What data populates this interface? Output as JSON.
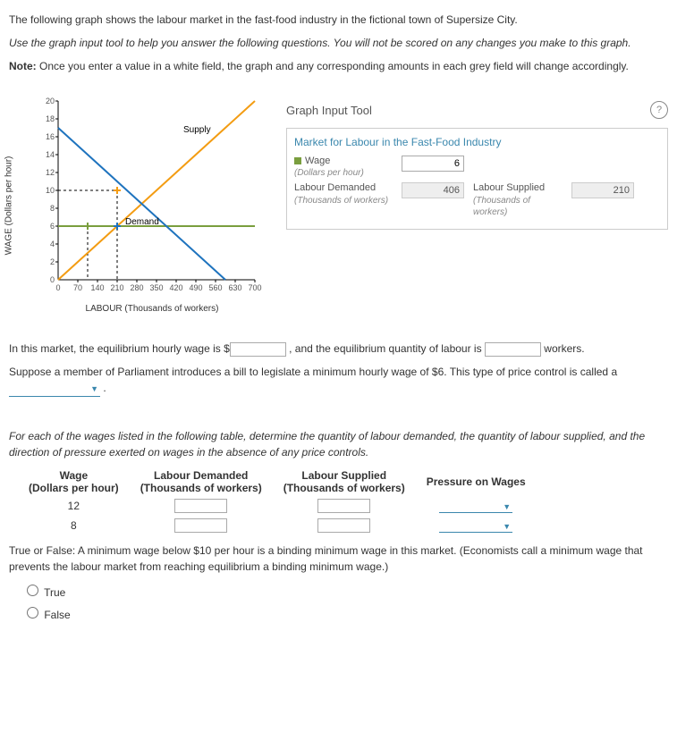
{
  "intro": "The following graph shows the labour market in the fast-food industry in the fictional town of Supersize City.",
  "instruct1": "Use the graph input tool to help you answer the following questions. You will not be scored on any changes you make to this graph.",
  "instruct2_prefix": "Note:",
  "instruct2": " Once you enter a value in a white field, the graph and any corresponding amounts in each grey field will change accordingly.",
  "chart_data": {
    "type": "line",
    "title": "",
    "xlabel": "LABOUR (Thousands of workers)",
    "ylabel": "WAGE (Dollars per hour)",
    "x_ticks": [
      0,
      70,
      140,
      210,
      280,
      350,
      420,
      490,
      560,
      630,
      700
    ],
    "y_ticks": [
      0,
      2,
      4,
      6,
      8,
      10,
      12,
      14,
      16,
      18,
      20
    ],
    "xlim": [
      0,
      700
    ],
    "ylim": [
      0,
      20
    ],
    "series": [
      {
        "name": "Demand",
        "color": "#1e73be",
        "points": [
          [
            0,
            17
          ],
          [
            595,
            0
          ]
        ]
      },
      {
        "name": "Supply",
        "color": "#f39c12",
        "points": [
          [
            0,
            0
          ],
          [
            700,
            20
          ]
        ]
      },
      {
        "name": "Wage line",
        "color": "#7a9e3e",
        "points": [
          [
            0,
            6
          ],
          [
            700,
            6
          ]
        ]
      }
    ],
    "markers": [
      {
        "x": 210,
        "y": 6,
        "color": "#1e73be"
      },
      {
        "x": 105,
        "y": 6,
        "color": "#7a9e3e"
      },
      {
        "x": 210,
        "y": 10,
        "color": "#f39c12"
      }
    ],
    "guides": [
      {
        "type": "v",
        "x": 105,
        "y1": 0,
        "y2": 6
      },
      {
        "type": "v",
        "x": 210,
        "y1": 0,
        "y2": 10
      },
      {
        "type": "h",
        "y": 10,
        "x1": 0,
        "x2": 210
      }
    ]
  },
  "tool": {
    "header": "Graph Input Tool",
    "market_title": "Market for Labour in the Fast-Food Industry",
    "wage_label": "Wage",
    "wage_sub": "(Dollars per hour)",
    "wage_value": "6",
    "demand_label": "Labour Demanded",
    "demand_sub": "(Thousands of workers)",
    "demand_value": "406",
    "supply_label": "Labour Supplied",
    "supply_sub": "(Thousands of workers)",
    "supply_value": "210"
  },
  "q1": {
    "pre": "In this market, the equilibrium hourly wage is ",
    "prefix": "$",
    "mid": " , and the equilibrium quantity of labour is ",
    "suffix": " workers."
  },
  "q2": {
    "text": "Suppose a member of Parliament introduces a bill to legislate a minimum hourly wage of $6. This type of price control is called a ",
    "suffix": " ."
  },
  "q3": {
    "intro": "For each of the wages listed in the following table, determine the quantity of labour demanded, the quantity of labour supplied, and the direction of pressure exerted on wages in the absence of any price controls.",
    "headers": {
      "wage": "Wage",
      "wage_sub": "(Dollars per hour)",
      "demand": "Labour Demanded",
      "demand_sub": "(Thousands of workers)",
      "supply": "Labour Supplied",
      "supply_sub": "(Thousands of workers)",
      "pressure": "Pressure on Wages"
    },
    "rows": [
      {
        "wage": "12"
      },
      {
        "wage": "8"
      }
    ]
  },
  "q4": {
    "text": "True or False: A minimum wage below $10 per hour is a binding minimum wage in this market. (Economists call a minimum wage that prevents the labour market from reaching equilibrium a binding minimum wage.)",
    "opt_true": "True",
    "opt_false": "False"
  }
}
